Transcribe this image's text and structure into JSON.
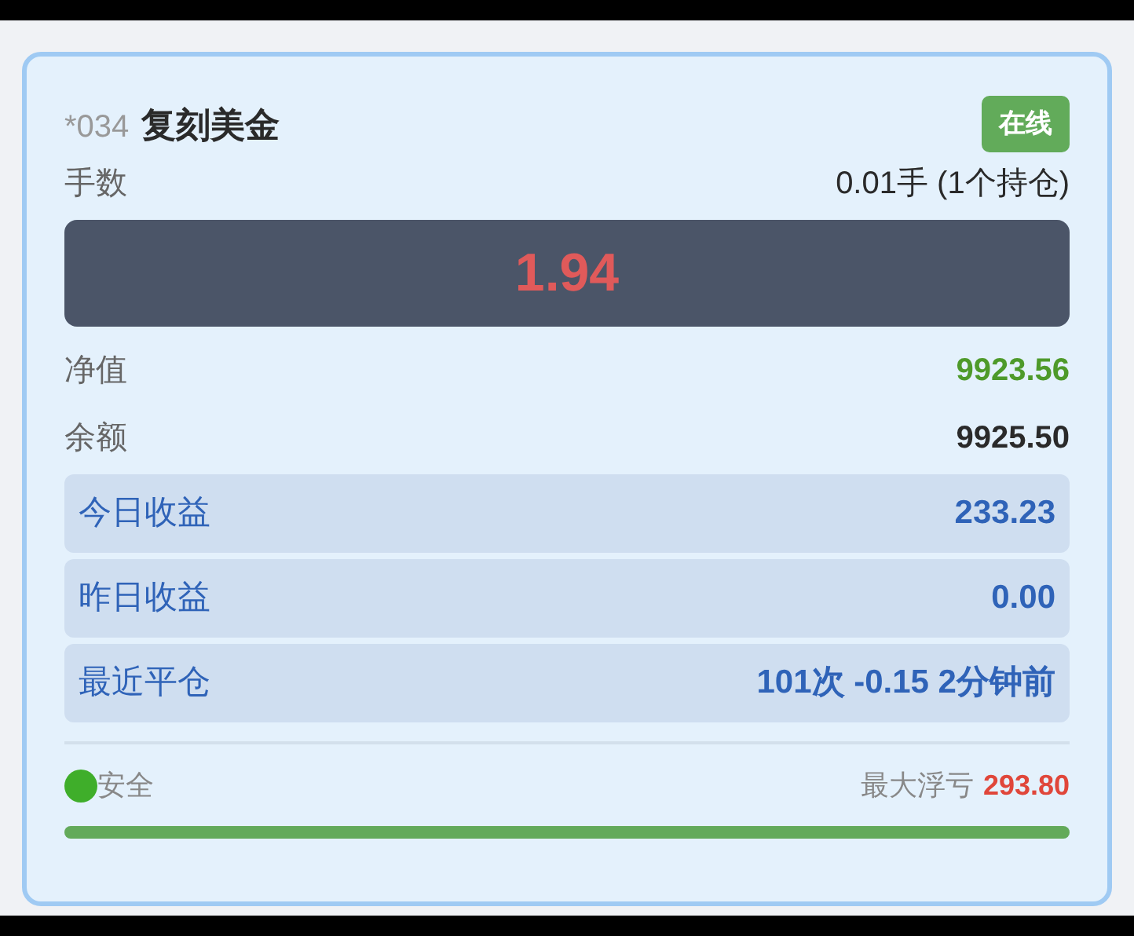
{
  "account": {
    "id": "*034",
    "name": "复刻美金",
    "status": "在线"
  },
  "lots": {
    "label": "手数",
    "value": "0.01手 (1个持仓)"
  },
  "profit": "1.94",
  "stats": [
    {
      "label": "净值",
      "value": "9923.56",
      "kind": "positive"
    },
    {
      "label": "余额",
      "value": "9925.50",
      "kind": "plain"
    },
    {
      "label": "今日收益",
      "value": "233.23",
      "kind": "highlight"
    },
    {
      "label": "昨日收益",
      "value": "0.00",
      "kind": "highlight"
    },
    {
      "label": "最近平仓",
      "value": "101次 -0.15 2分钟前",
      "kind": "highlight"
    }
  ],
  "footer": {
    "risk": {
      "label": "安全",
      "color": "#3fae2a"
    },
    "max_drawdown_label": "最大浮亏",
    "max_drawdown_value": "293.80",
    "level": 1
  }
}
